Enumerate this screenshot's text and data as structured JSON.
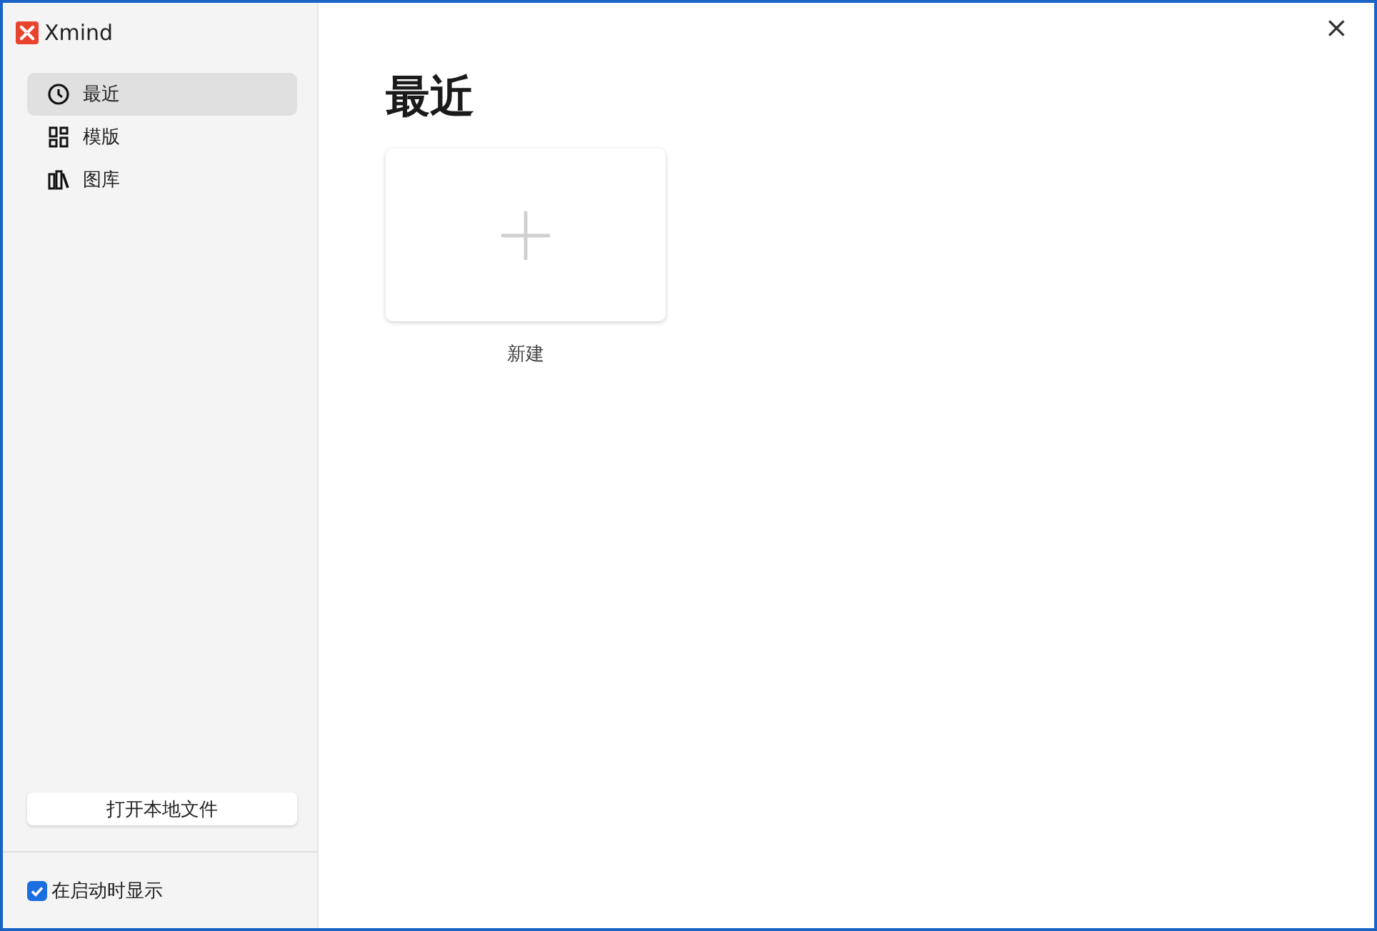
{
  "window": {
    "title": "Xmind",
    "close": "×"
  },
  "sidebar": {
    "items": [
      {
        "kind": "clock",
        "label": "最近",
        "selected": true
      },
      {
        "kind": "grid",
        "label": "模版",
        "selected": false
      },
      {
        "kind": "library",
        "label": "图库",
        "selected": false
      }
    ],
    "open_button": "打开本地文件",
    "show_on_startup": {
      "label": "在启动时显示",
      "checked": true
    }
  },
  "main": {
    "heading": "最近",
    "cards": [
      {
        "label": "新建"
      }
    ]
  }
}
